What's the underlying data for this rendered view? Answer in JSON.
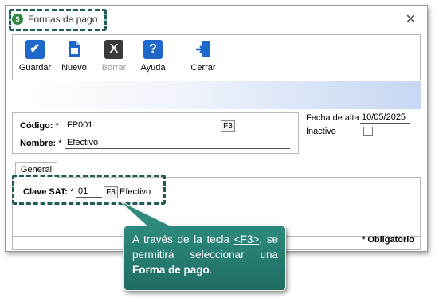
{
  "window": {
    "title": "Formas de pago",
    "icon": "dollar-app-icon",
    "close_icon": "close-icon"
  },
  "toolbar": {
    "save_label": "Guardar",
    "new_label": "Nuevo",
    "delete_label": "Borrar",
    "help_label": "Ayuda",
    "close_label": "Cerrar",
    "icons": {
      "save": "check-icon",
      "new": "document-icon",
      "delete": "delete-x-icon",
      "help": "question-icon",
      "close": "exit-door-icon"
    }
  },
  "form": {
    "codigo_label": "Código:",
    "codigo_value": "FP001",
    "nombre_label": "Nombre:",
    "nombre_value": "Efectivo",
    "required_mark": "*",
    "f3_label": "F3",
    "fecha_label": "Fecha de alta:",
    "fecha_value": "10/05/2025",
    "inactivo_label": "Inactivo",
    "inactivo_checked": false
  },
  "tabs": [
    {
      "label": "General",
      "selected": true
    }
  ],
  "general": {
    "clave_label": "Clave SAT:",
    "clave_value": "01",
    "clave_desc": "Efectivo",
    "f3_label": "F3"
  },
  "status": {
    "required_note": "* Obligatorio"
  },
  "callout": {
    "text_before": "A través de la tecla ",
    "key": "<F3>",
    "text_middle": ", se permitirá seleccionar una ",
    "bold": "Forma de pago",
    "text_after": "."
  },
  "colors": {
    "accent": "#1f6d63",
    "button_blue": "#1f67c8",
    "button_dark": "#3a3a3a"
  }
}
